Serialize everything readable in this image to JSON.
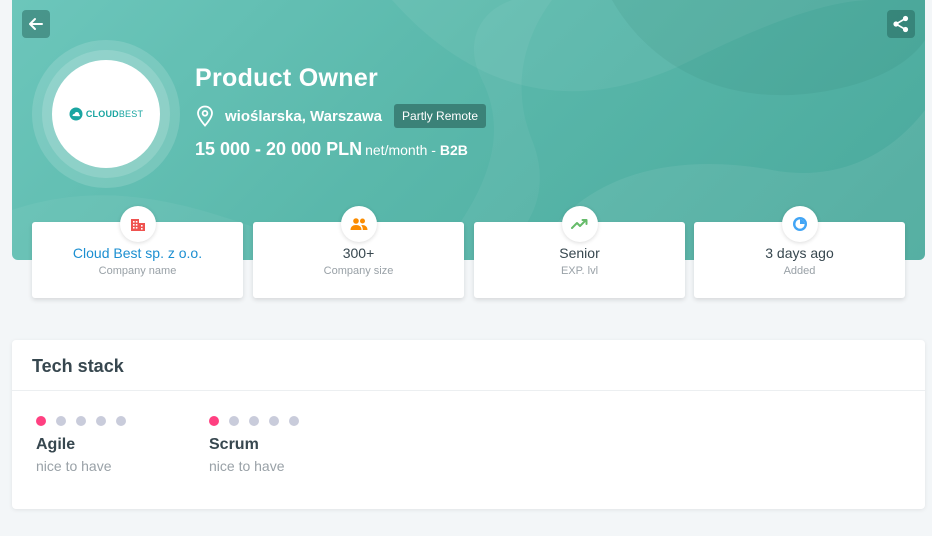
{
  "header": {
    "back_icon": "arrow-left-icon",
    "share_icon": "share-icon",
    "company_logo": {
      "brand": "CLOUD",
      "suffix": "BEST",
      "color": "#1aa5a1"
    },
    "title": "Product Owner",
    "location": "wioślarska, Warszawa",
    "remote_badge": "Partly Remote",
    "salary": "15 000 - 20 000 PLN",
    "salary_unit": "net/month",
    "salary_separator": " - ",
    "contract_type": "B2B",
    "hero_color": "#5ab8ab"
  },
  "info_cards": [
    {
      "icon": "building-icon",
      "icon_color": "#ef5350",
      "value": "Cloud Best sp. z o.o.",
      "label": "Company name"
    },
    {
      "icon": "people-icon",
      "icon_color": "#fb8c00",
      "value": "300+",
      "label": "Company size"
    },
    {
      "icon": "trend-up-icon",
      "icon_color": "#66bb6a",
      "value": "Senior",
      "label": "EXP. lvl"
    },
    {
      "icon": "clock-icon",
      "icon_color": "#42a5f5",
      "value": "3 days ago",
      "label": "Added"
    }
  ],
  "tech_stack": {
    "title": "Tech stack",
    "level_active_color": "#ff4081",
    "items": [
      {
        "name": "Agile",
        "level": "nice to have",
        "score": 1,
        "max": 5
      },
      {
        "name": "Scrum",
        "level": "nice to have",
        "score": 1,
        "max": 5
      }
    ]
  }
}
